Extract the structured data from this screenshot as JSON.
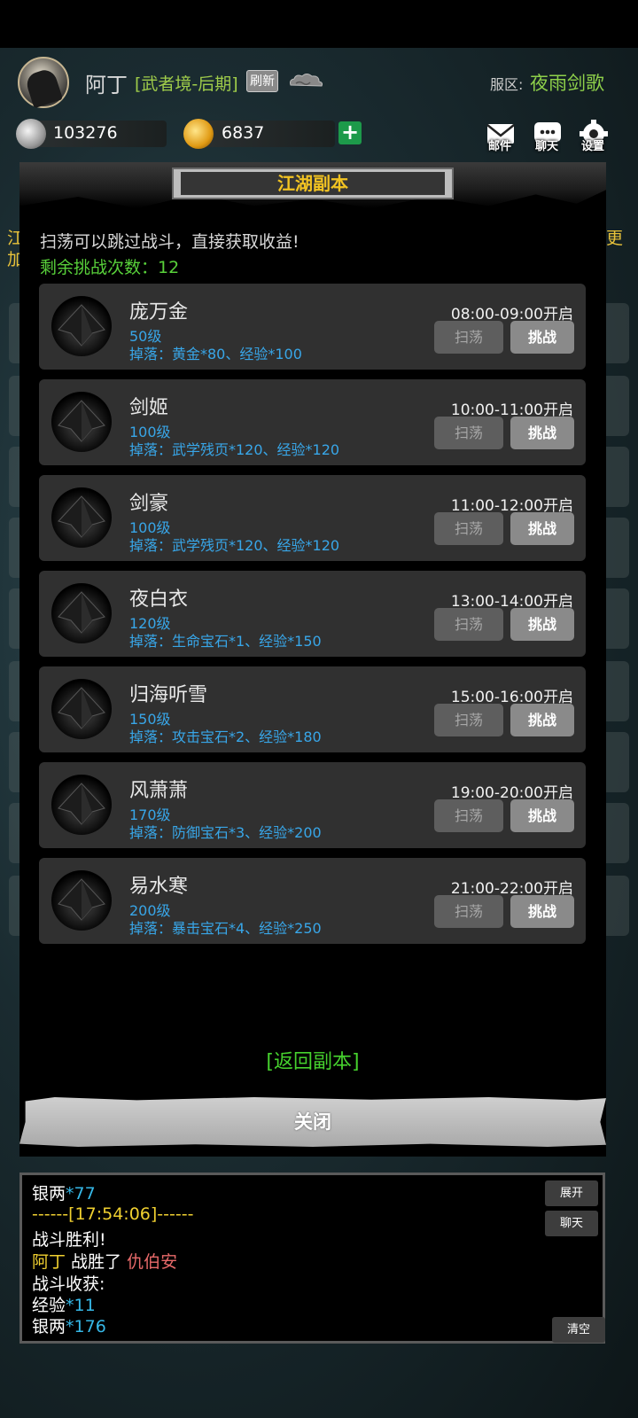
{
  "player": {
    "name": "阿丁",
    "realm": "[武者境-后期]",
    "refresh_label": "刷新",
    "server_label": "服区:",
    "server_name": "夜雨剑歌"
  },
  "currency": {
    "silver": "103276",
    "gold": "6837",
    "silver_icon": "silver-ingot-icon",
    "gold_icon": "gold-ingot-icon"
  },
  "top_icons": {
    "mail_label": "邮件",
    "chat_label": "聊天",
    "settings_label": "设置"
  },
  "side_glimpse": {
    "left_1": "江",
    "left_2": "加",
    "right_1": "更"
  },
  "modal": {
    "title": "江湖副本",
    "hint": "扫荡可以跳过战斗，直接获取收益!",
    "remaining": "剩余挑战次数：12",
    "sweep_label": "扫荡",
    "challenge_label": "挑战",
    "back_label": "[返回副本]",
    "close_label": "关闭",
    "dungeons": [
      {
        "name": "庞万金",
        "level": "50级",
        "drop": "掉落：黄金*80、经验*100",
        "time": "08:00-09:00开启"
      },
      {
        "name": "剑姬",
        "level": "100级",
        "drop": "掉落：武学残页*120、经验*120",
        "time": "10:00-11:00开启"
      },
      {
        "name": "剑豪",
        "level": "100级",
        "drop": "掉落：武学残页*120、经验*120",
        "time": "11:00-12:00开启"
      },
      {
        "name": "夜白衣",
        "level": "120级",
        "drop": "掉落：生命宝石*1、经验*150",
        "time": "13:00-14:00开启"
      },
      {
        "name": "归海听雪",
        "level": "150级",
        "drop": "掉落：攻击宝石*2、经验*180",
        "time": "15:00-16:00开启"
      },
      {
        "name": "风萧萧",
        "level": "170级",
        "drop": "掉落：防御宝石*3、经验*200",
        "time": "19:00-20:00开启"
      },
      {
        "name": "易水寒",
        "level": "200级",
        "drop": "掉落：暴击宝石*4、经验*250",
        "time": "21:00-22:00开启"
      }
    ]
  },
  "log": {
    "line1_a": "银两",
    "line1_b": "*77",
    "line2": "------[17:54:06]------",
    "line3": "战斗胜利!",
    "line4_a": "阿丁",
    "line4_b": " 战胜了 ",
    "line4_c": "仇伯安",
    "line5": "战斗收获:",
    "line6_a": "经验",
    "line6_b": "*11",
    "line7_a": "银两",
    "line7_b": "*176",
    "expand_label": "展开",
    "chat_label": "聊天",
    "clear_label": "清空"
  }
}
